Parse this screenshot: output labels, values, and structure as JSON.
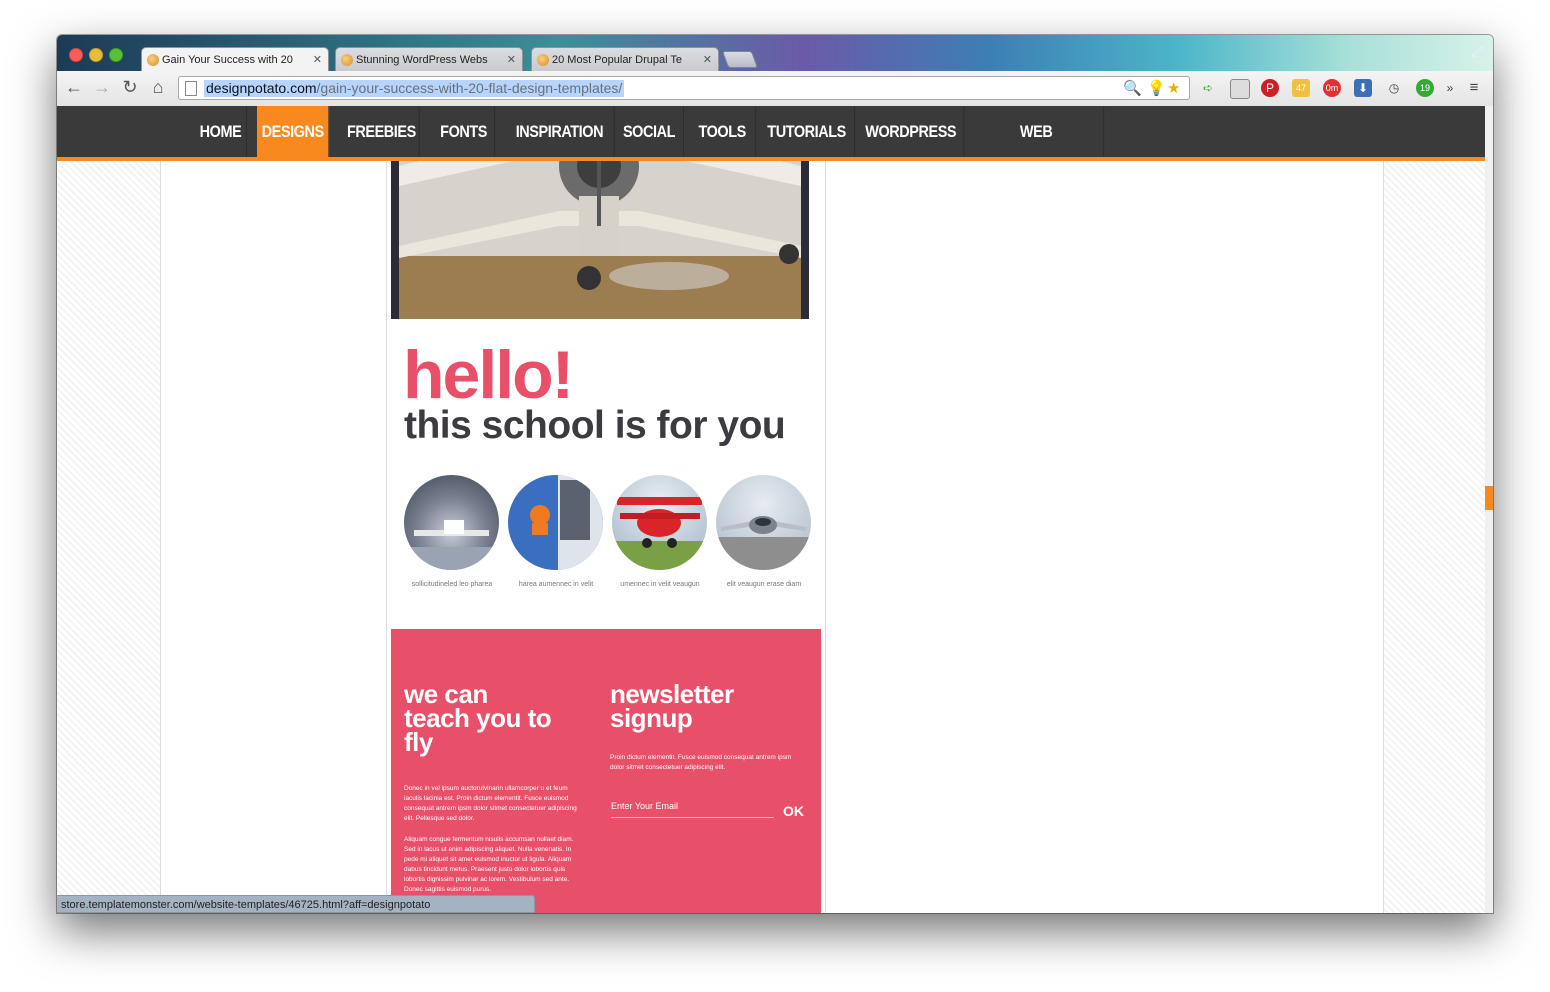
{
  "browser": {
    "tabs": [
      {
        "title": "Gain Your Success with 20",
        "active": true
      },
      {
        "title": "Stunning WordPress Webs",
        "active": false
      },
      {
        "title": "20 Most Popular Drupal Te",
        "active": false
      }
    ],
    "url_host": "designpotato.com",
    "url_path": "/gain-your-success-with-20-flat-design-templates/",
    "status_url": "store.templatemonster.com/website-templates/46725.html?aff=designpotato",
    "ext_badges": {
      "weather": "47",
      "timer": "0m",
      "mail": "19"
    }
  },
  "nav": {
    "items": [
      "HOME",
      "DESIGNS",
      "FREEBIES",
      "FONTS",
      "INSPIRATION",
      "SOCIAL",
      "TOOLS",
      "TUTORIALS",
      "WORDPRESS",
      "WEB DEVELOPMENT"
    ],
    "active": "DESIGNS"
  },
  "preview": {
    "hello": "hello!",
    "tagline": "this school is for you",
    "captions": [
      "sollicitudineled leo pharea",
      "harea aumennec in velit",
      "umennec in velit veaugun",
      "elit veaugun erase diam"
    ],
    "teach_heading": "we can teach you to fly",
    "teach_text_1": "Donec in vel ipsum auctorulvinarin ullamcorper u et feum iaculis lacinia est. Proin dictum elementit. Fusce euismod consequat antrem ipsm dolor sitmet consectetuer adipiscing elit. Pellesque sed dolor.",
    "teach_text_2": "Aliquam congue fermentum nisulis accumsan nullaet diam. Sed in lacus ut enim adipiscing aliquet. Nulla venenatis. In pede mi aliquet sit amet euismod inuctor ut ligula. Aliquam dabus tincidunt metus. Praesent justo dolor lobortis quis lobortis dignissim pulvinar ac lorem. Vestibulum sed ante. Donec sagittis euismod purus.",
    "newsletter_heading": "newsletter signup",
    "newsletter_text": "Proin dictum elementit. Fusce euismod consequat antrem ipsm dolor sitmet consectetuer adipiscing elit.",
    "email_placeholder": "Enter Your Email",
    "ok_label": "OK"
  },
  "colors": {
    "accent": "#f7891f",
    "pink": "#e8506a",
    "nav_bg": "#3a3a3a"
  }
}
